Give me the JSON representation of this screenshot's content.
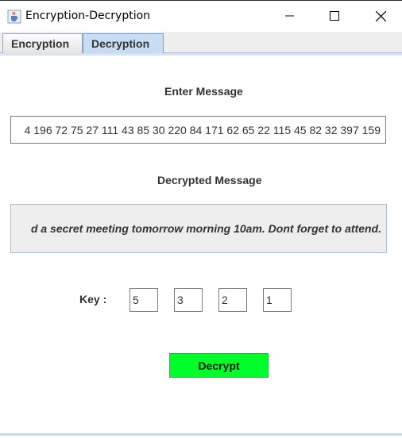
{
  "window": {
    "title": "Encryption-Decryption",
    "icon": "java-cup-icon"
  },
  "tabs": [
    {
      "label": "Encryption",
      "selected": false
    },
    {
      "label": "Decryption",
      "selected": true
    }
  ],
  "form": {
    "enter_label": "Enter Message",
    "message_value": "4 196 72 75 27 111 43 85 30 220 84 171 62 65 22 115 45 82 32 397 159",
    "decrypted_label": "Decrypted Message",
    "decrypted_value": "d a secret meeting tomorrow morning 10am. Dont forget to attend.",
    "key_label": "Key :",
    "keys": [
      "5",
      "3",
      "2",
      "1"
    ],
    "decrypt_button": "Decrypt"
  },
  "colors": {
    "button_bg": "#00ff2a",
    "selected_tab_bg": "#c8ddf2",
    "result_bg": "#eeeeee"
  }
}
